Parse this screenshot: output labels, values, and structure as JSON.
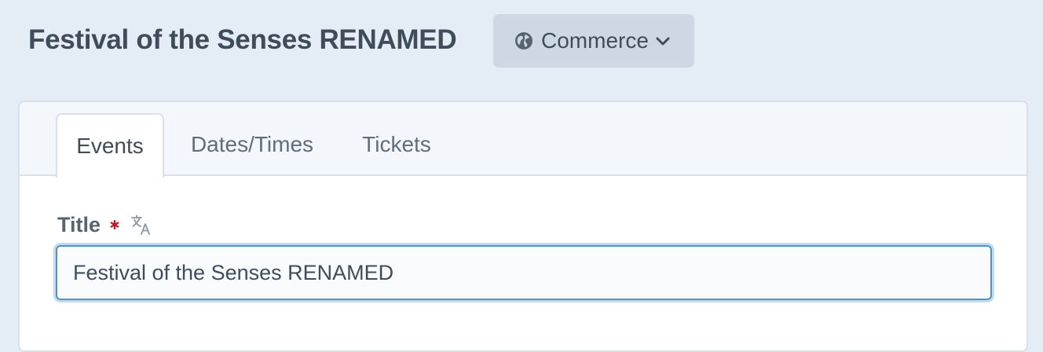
{
  "header": {
    "title": "Festival of the Senses RENAMED",
    "site_menu": {
      "label": "Commerce",
      "icon": "globe-icon",
      "dropdown_icon": "chevron-down-icon"
    }
  },
  "tabs": [
    {
      "label": "Events",
      "active": true
    },
    {
      "label": "Dates/Times",
      "active": false
    },
    {
      "label": "Tickets",
      "active": false
    }
  ],
  "form": {
    "title_field": {
      "label": "Title",
      "required": true,
      "translatable_icon": "translate-icon",
      "value": "Festival of the Senses RENAMED"
    }
  },
  "colors": {
    "page_background": "#e4ecf5",
    "text_dark": "#3f4d5a",
    "required_marker": "#cf1124",
    "focus_border": "#4e93c7"
  }
}
